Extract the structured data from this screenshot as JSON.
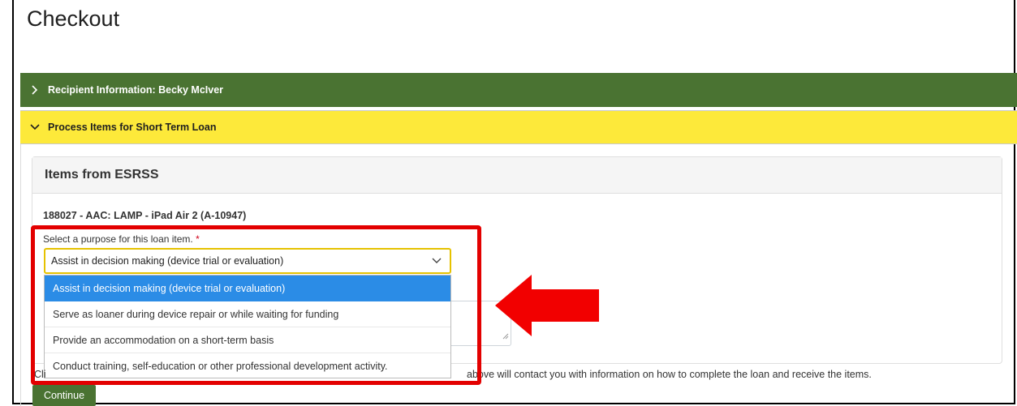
{
  "page": {
    "title": "Checkout"
  },
  "sections": {
    "recipient": {
      "label": "Recipient Information: Becky McIver"
    },
    "process": {
      "label": "Process Items for Short Term Loan"
    }
  },
  "card": {
    "header": "Items from ESRSS",
    "item_title": "188027 - AAC: LAMP - iPad Air 2 (A-10947)",
    "purpose_label": "Select a purpose for this loan item.",
    "required_mark": "*",
    "purpose_value": "Assist in decision making (device trial or evaluation)",
    "options": [
      "Assist in decision making (device trial or evaluation)",
      "Serve as loaner during device repair or while waiting for funding",
      "Provide an accommodation on a short-term basis",
      "Conduct training, self-education or other professional development activity."
    ]
  },
  "footer": {
    "click_text_left": "Cli",
    "click_text_right": "above will contact you with information on how to complete the loan and receive the items.",
    "continue_label": "Continue"
  },
  "colors": {
    "green_bar": "#4a7332",
    "yellow_bar": "#fde93a",
    "selected_option": "#2b8ce6",
    "highlight": "#e30000"
  },
  "icons": {
    "recipient_toggle": "chevron-right-icon",
    "process_toggle": "chevron-down-icon",
    "select_toggle": "chevron-down-icon",
    "annotation": "red-arrow-icon"
  }
}
